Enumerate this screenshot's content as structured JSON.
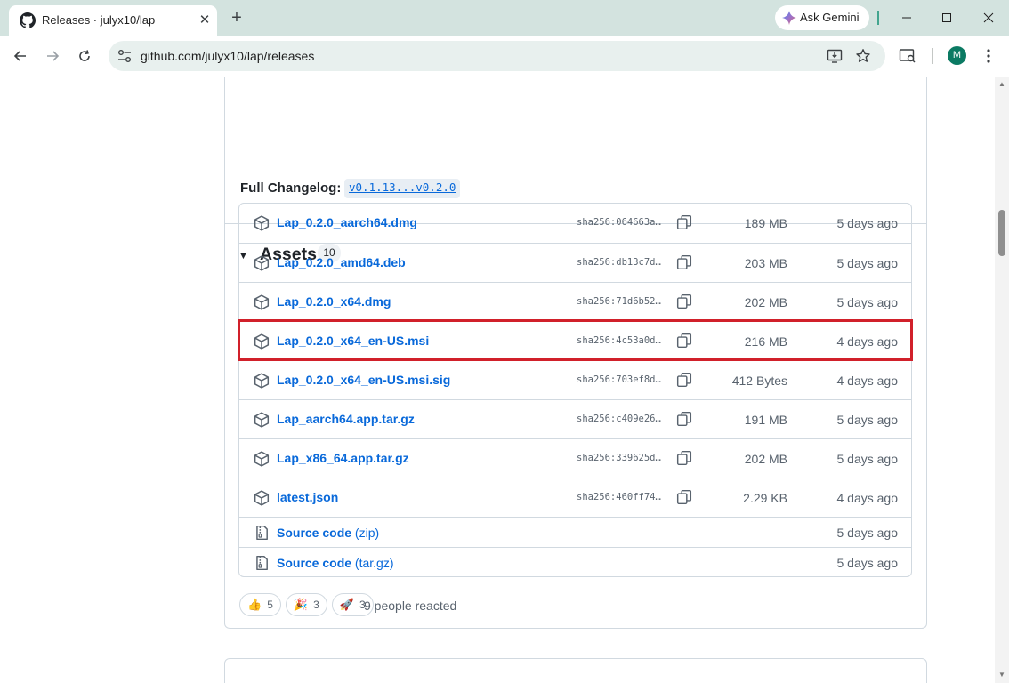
{
  "browser": {
    "tab_title": "Releases · julyx10/lap",
    "tab_close_glyph": "✕",
    "new_tab_glyph": "+",
    "gemini_label": "Ask Gemini",
    "url": "github.com/julyx10/lap/releases",
    "avatar_initial": "M",
    "accent_color": "#43a58f"
  },
  "release": {
    "partial_text": "",
    "changelog_label": "Full Changelog:",
    "changelog_link": "v0.1.13...v0.2.0",
    "assets_title": "Assets",
    "assets_count": "10",
    "assets": [
      {
        "name": "Lap_0.2.0_aarch64.dmg",
        "sha": "sha256:064663a…",
        "size": "189 MB",
        "date": "5 days ago"
      },
      {
        "name": "Lap_0.2.0_amd64.deb",
        "sha": "sha256:db13c7d…",
        "size": "203 MB",
        "date": "5 days ago"
      },
      {
        "name": "Lap_0.2.0_x64.dmg",
        "sha": "sha256:71d6b52…",
        "size": "202 MB",
        "date": "5 days ago"
      },
      {
        "name": "Lap_0.2.0_x64_en-US.msi",
        "sha": "sha256:4c53a0d…",
        "size": "216 MB",
        "date": "4 days ago"
      },
      {
        "name": "Lap_0.2.0_x64_en-US.msi.sig",
        "sha": "sha256:703ef8d…",
        "size": "412 Bytes",
        "date": "4 days ago"
      },
      {
        "name": "Lap_aarch64.app.tar.gz",
        "sha": "sha256:c409e26…",
        "size": "191 MB",
        "date": "5 days ago"
      },
      {
        "name": "Lap_x86_64.app.tar.gz",
        "sha": "sha256:339625d…",
        "size": "202 MB",
        "date": "5 days ago"
      },
      {
        "name": "latest.json",
        "sha": "sha256:460ff74…",
        "size": "2.29 KB",
        "date": "4 days ago"
      }
    ],
    "source_code": [
      {
        "label": "Source code",
        "format": "(zip)",
        "date": "5 days ago"
      },
      {
        "label": "Source code",
        "format": "(tar.gz)",
        "date": "5 days ago"
      }
    ],
    "reactions": [
      {
        "emoji": "👍",
        "count": "5"
      },
      {
        "emoji": "🎉",
        "count": "3"
      },
      {
        "emoji": "🚀",
        "count": "3"
      }
    ],
    "reacted_text": "9 people reacted",
    "highlight_color": "#d1202a"
  }
}
